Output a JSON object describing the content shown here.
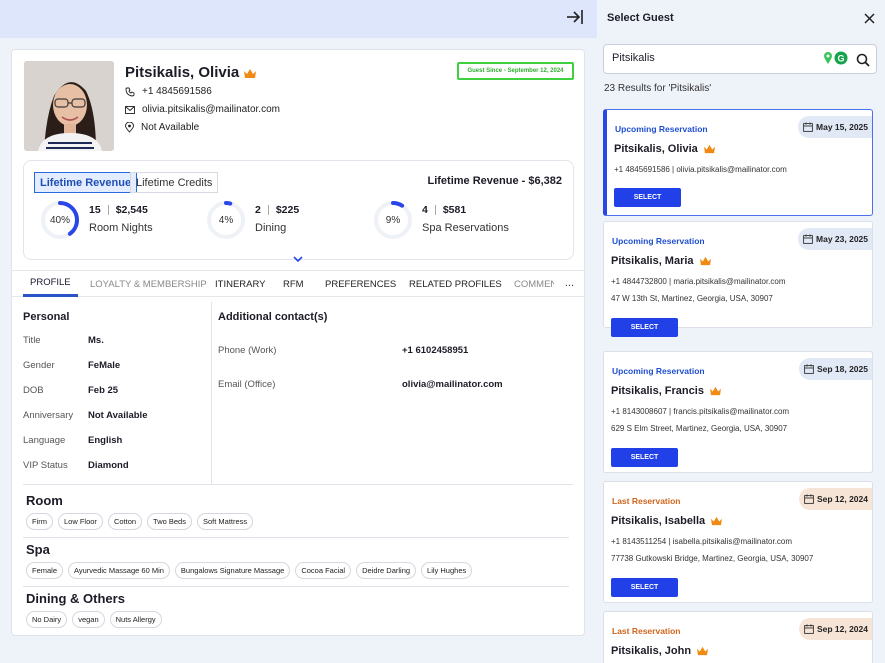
{
  "profile": {
    "name": "Pitsikalis, Olivia",
    "phone": "+1 4845691586",
    "email": "olivia.pitsikalis@mailinator.com",
    "location": "Not Available",
    "guest_since": "Guest Since - September 12, 2024"
  },
  "revenue": {
    "tab_active": "Lifetime Revenue",
    "tab_inactive": "Lifetime Credits",
    "total": "Lifetime Revenue - $6,382",
    "metrics": [
      {
        "pct_label": "40%",
        "pct": 40,
        "count": "15",
        "amount": "$2,545",
        "label": "Room Nights"
      },
      {
        "pct_label": "4%",
        "pct": 4,
        "count": "2",
        "amount": "$225",
        "label": "Dining"
      },
      {
        "pct_label": "9%",
        "pct": 9,
        "count": "4",
        "amount": "$581",
        "label": "Spa Reservations"
      }
    ]
  },
  "tabs": [
    "PROFILE",
    "LOYALTY & MEMBERSHIP",
    "ITINERARY",
    "RFM",
    "PREFERENCES",
    "RELATED PROFILES",
    "COMMEN",
    "..."
  ],
  "personal": {
    "title": "Personal",
    "fields": [
      {
        "label": "Title",
        "value": "Ms."
      },
      {
        "label": "Gender",
        "value": "FeMale"
      },
      {
        "label": "DOB",
        "value": "Feb 25"
      },
      {
        "label": "Anniversary",
        "value": "Not Available"
      },
      {
        "label": "Language",
        "value": "English"
      },
      {
        "label": "VIP Status",
        "value": "Diamond"
      }
    ]
  },
  "additional": {
    "title": "Additional contact(s)",
    "fields": [
      {
        "label": "Phone (Work)",
        "value": "+1 6102458951"
      },
      {
        "label": "Email (Office)",
        "value": "olivia@mailinator.com"
      }
    ]
  },
  "preferences": [
    {
      "title": "Room",
      "chips": [
        "Firm",
        "Low Floor",
        "Cotton",
        "Two Beds",
        "Soft Mattress"
      ]
    },
    {
      "title": "Spa",
      "chips": [
        "Female",
        "Ayurvedic Massage 60 Min",
        "Bungalows Signature Massage",
        "Cocoa Facial",
        "Deidre Darling",
        "Lily Hughes"
      ]
    },
    {
      "title": "Dining & Others",
      "chips": [
        "No Dairy",
        "vegan",
        "Nuts Allergy"
      ]
    }
  ],
  "select_guest": {
    "title": "Select Guest",
    "search_value": "Pitsikalis",
    "results_text": "23 Results for 'Pitsikalis'",
    "select_label": "SELECT",
    "results": [
      {
        "status": "Upcoming Reservation",
        "date": "May 15, 2025",
        "name": "Pitsikalis, Olivia",
        "contact": "+1 4845691586 | olivia.pitsikalis@mailinator.com",
        "address": ""
      },
      {
        "status": "Upcoming Reservation",
        "date": "May 23, 2025",
        "name": "Pitsikalis, Maria",
        "contact": "+1 4844732800 | maria.pitsikalis@mailinator.com",
        "address": "47 W 13th St, Martinez, Georgia, USA, 30907"
      },
      {
        "status": "Upcoming Reservation",
        "date": "Sep 18, 2025",
        "name": "Pitsikalis, Francis",
        "contact": "+1 8143008607 | francis.pitsikalis@mailinator.com",
        "address": "629 S Elm Street, Martinez, Georgia, USA, 30907"
      },
      {
        "status": "Last Reservation",
        "date": "Sep 12, 2024",
        "name": "Pitsikalis, Isabella",
        "contact": "+1 8143511254 | isabella.pitsikalis@mailinator.com",
        "address": "77738 Gutkowski Bridge, Martinez, Georgia, USA, 30907"
      },
      {
        "status": "Last Reservation",
        "date": "Sep 12, 2024",
        "name": "Pitsikalis, John",
        "contact": "",
        "address": ""
      }
    ]
  },
  "colors": {
    "accent": "#2140e8",
    "upcoming": "#1f4fd1",
    "last": "#d0651d",
    "crown": "#f08a12",
    "since_border": "#3fd03f"
  },
  "icons": [
    "collapse-panel-icon",
    "crown-icon",
    "phone-icon",
    "mail-icon",
    "location-pin-icon",
    "chevron-down-icon",
    "close-icon",
    "search-icon",
    "calendar-icon"
  ]
}
